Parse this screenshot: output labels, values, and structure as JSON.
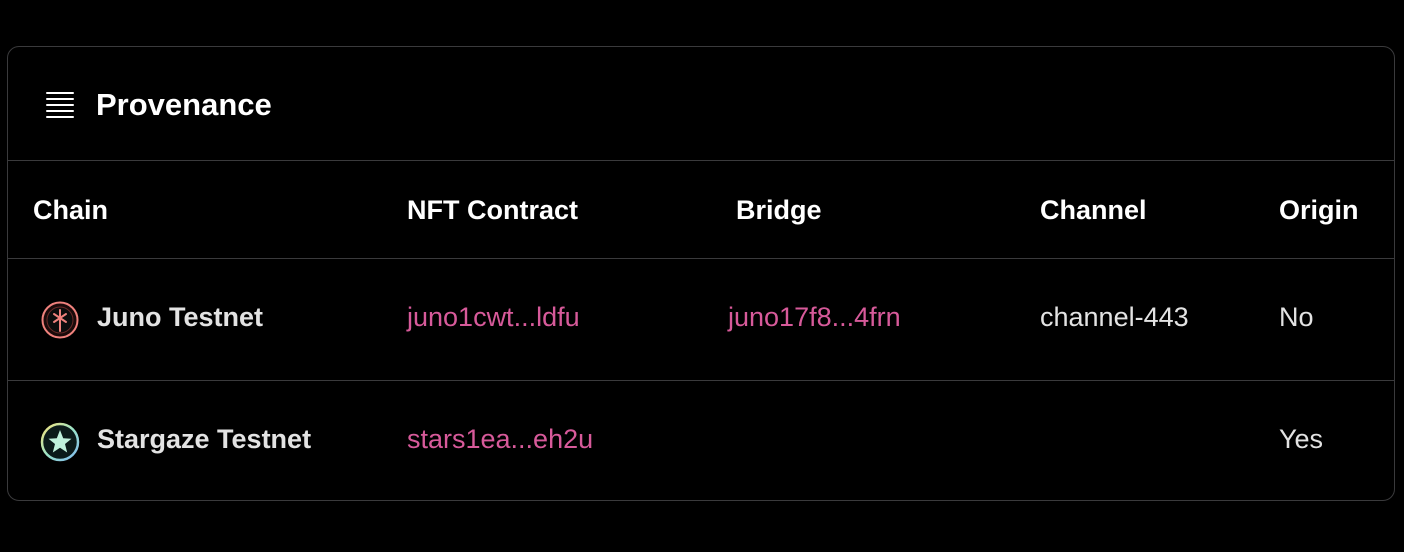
{
  "panel": {
    "title": "Provenance",
    "icon": "list-icon"
  },
  "table": {
    "columns": [
      "Chain",
      "NFT Contract",
      "Bridge",
      "Channel",
      "Origin"
    ],
    "rows": [
      {
        "chain": "Juno Testnet",
        "chain_icon": "juno-logo-icon",
        "nft_contract": "juno1cwt...ldfu",
        "bridge": "juno17f8...4frn",
        "channel": "channel-443",
        "origin": "No"
      },
      {
        "chain": "Stargaze Testnet",
        "chain_icon": "stargaze-logo-icon",
        "nft_contract": "stars1ea...eh2u",
        "bridge": "",
        "channel": "",
        "origin": "Yes"
      }
    ]
  },
  "colors": {
    "background": "#000000",
    "border": "#3a3a3c",
    "text": "#e3e3e3",
    "link": "#d75a9a",
    "juno_accent": "#f0827d",
    "stargaze_accent": "#a8e6cf"
  }
}
